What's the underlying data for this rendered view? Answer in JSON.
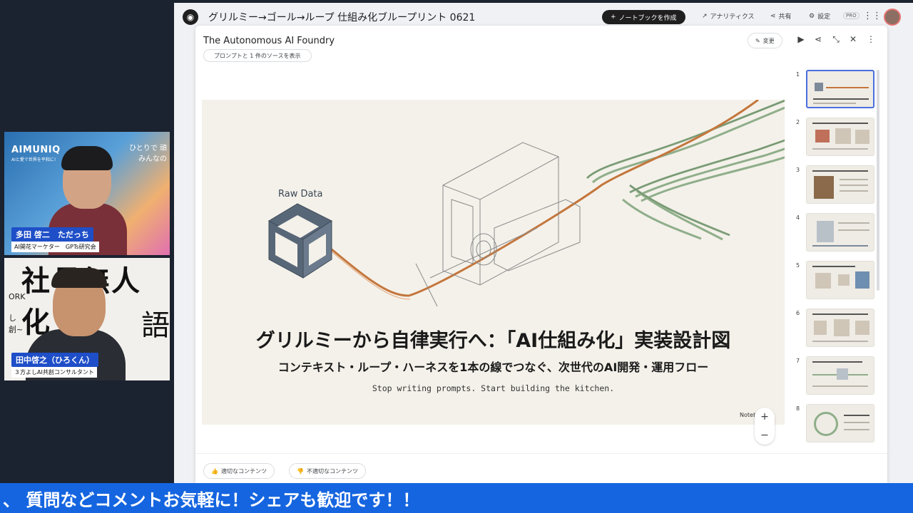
{
  "notebook": {
    "title": "グリルミー→ゴール→ループ 仕組み化ブループリント 0621",
    "create_button": "ノートブックを作成",
    "analytics": "アナリティクス",
    "share": "共有",
    "settings": "設定",
    "pro_badge": "PRO"
  },
  "modal": {
    "title": "The Autonomous AI Foundry",
    "prompt_chip": "プロンプトと 1 件のソースを表示",
    "change_button": "変更",
    "feedback_good": "適切なコンテンツ",
    "feedback_bad": "不適切なコンテンツ"
  },
  "slide": {
    "raw_label": "Raw Data",
    "headline": "グリルミーから自律実行へ：「AI仕組み化」実装設計図",
    "subheadline": "コンテキスト・ループ・ハーネスを1本の線でつなぐ、次世代のAI開発・運用フロー",
    "tagline": "Stop writing prompts. Start building the kitchen.",
    "brand": "Notebo...LM",
    "zoom_in": "+",
    "zoom_out": "−"
  },
  "thumbnails": [
    {
      "num": "1"
    },
    {
      "num": "2"
    },
    {
      "num": "3"
    },
    {
      "num": "4"
    },
    {
      "num": "5"
    },
    {
      "num": "6"
    },
    {
      "num": "7"
    },
    {
      "num": "8"
    }
  ],
  "stream": {
    "cam1": {
      "brand": "AIMUNIQ",
      "brand_sub": "AIと愛で世界を平和に!",
      "tag_line1": "ひとりで 頑",
      "tag_line2": "みんなの",
      "name": "多田 啓二　ただっち",
      "role": "AI開花マーケター　GPTs研究会"
    },
    "cam2": {
      "big_text": "社長無人化",
      "side_text": "語",
      "small1": "ORK",
      "small2": "し",
      "small3": "創~",
      "name": "田中啓之（ひろくん）",
      "role": "３方よしAI共創コンサルタント"
    },
    "ticker": "、 質問などコメントお気軽に！シェアも歓迎です！！"
  }
}
